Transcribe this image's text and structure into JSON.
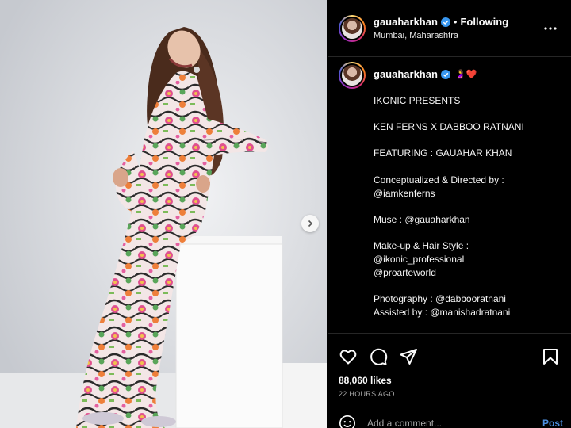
{
  "post": {
    "username": "gauaharkhan",
    "follow_status": "Following",
    "separator": "•",
    "location": "Mumbai, Maharashtra",
    "more_icon": "more-horizontal-icon",
    "next_icon": "chevron-right-icon"
  },
  "caption": {
    "username": "gauaharkhan",
    "emojis": "🤰❤️",
    "lines": [
      "IKONIC PRESENTS",
      "",
      "KEN FERNS X DABBOO RATNANI",
      "",
      "FEATURING : GAUAHAR KHAN",
      "",
      "Conceptualized & Directed by :",
      "@iamkenferns",
      "",
      "Muse : @gauaharkhan",
      "",
      "Make-up & Hair Style :",
      "@ikonic_professional",
      "@proarteworld",
      "",
      "Photography : @dabbooratnani",
      "Assisted by : @manishadratnani"
    ]
  },
  "engagement": {
    "likes": "88,060 likes",
    "time": "22 HOURS AGO"
  },
  "comment": {
    "placeholder": "Add a comment...",
    "post_label": "Post"
  },
  "colors": {
    "accent": "#4d8fe0",
    "verified": "#3897f0",
    "background": "#000000",
    "divider": "#262626"
  }
}
